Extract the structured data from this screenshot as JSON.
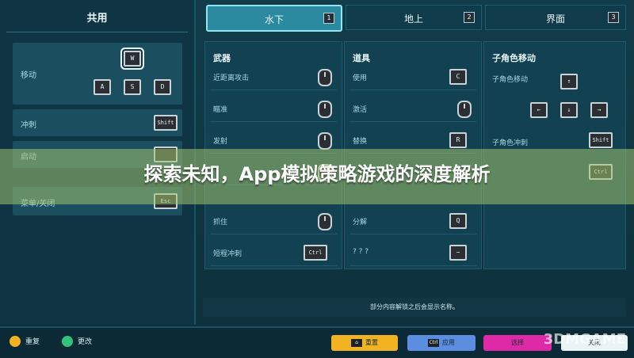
{
  "left": {
    "title": "共用",
    "rows": [
      {
        "label": "移动",
        "keys": [
          "W",
          "A",
          "S",
          "D"
        ]
      },
      {
        "label": "冲刺",
        "key": "Shift"
      },
      {
        "label": "启动",
        "key": ""
      },
      {
        "label": "菜单/关闭",
        "key": "Esc"
      }
    ]
  },
  "tabs": [
    {
      "label": "水下",
      "num": "1"
    },
    {
      "label": "地上",
      "num": "2"
    },
    {
      "label": "界面",
      "num": "3"
    }
  ],
  "columns": [
    {
      "title": "武器",
      "items": [
        {
          "label": "近距离攻击",
          "key": "mouse"
        },
        {
          "label": "瞄准",
          "key": "mouse"
        },
        {
          "label": "发射",
          "key": "mouse"
        },
        {
          "label": "",
          "key": "mouse"
        },
        {
          "label": "抓住",
          "key": "mouse"
        },
        {
          "label": "短程冲刺",
          "key": "Ctrl"
        }
      ]
    },
    {
      "title": "道具",
      "items": [
        {
          "label": "使用",
          "key": "C"
        },
        {
          "label": "激活",
          "key": "mouse"
        },
        {
          "label": "替换",
          "key": "R"
        },
        {
          "label": "",
          "key": ""
        },
        {
          "label": "分解",
          "key": "Q"
        },
        {
          "label": "? ? ?",
          "key": "~"
        }
      ]
    },
    {
      "title": "子角色移动",
      "items": [
        {
          "label": "子角色移动",
          "key": "↑"
        },
        {
          "label": "",
          "key": ""
        },
        {
          "label": "子角色冲刺",
          "key": "Shift"
        },
        {
          "label": "",
          "key": "Ctrl"
        }
      ]
    }
  ],
  "bottom_note": "部分内容解锁之后会显示名称。",
  "footer": {
    "reset": "重复",
    "change": "更改",
    "set": "重置",
    "apply": "应用",
    "select": "选择",
    "close": "关闭"
  },
  "headline": "探索未知，App模拟策略游戏的深度解析",
  "watermark": "3DMGAME",
  "colors": {
    "accent": "#8fe5f2",
    "panel": "#124151",
    "overlay": "#a0c36e"
  }
}
